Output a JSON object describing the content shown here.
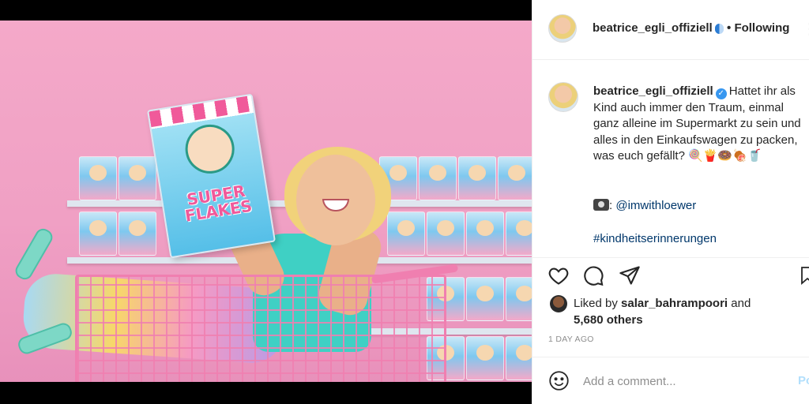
{
  "photo": {
    "package_title": "SUPER FLAKES"
  },
  "post": {
    "header": {
      "username": "beatrice_egli_offiziell",
      "separator": "•",
      "follow_status": "Following",
      "more": "⋮"
    },
    "caption": {
      "username": "beatrice_egli_offiziell",
      "verified_mark": "✓",
      "text": "Hattet ihr als Kind auch immer den Traum, einmal ganz alleine im Supermarkt zu sein und alles in den Einkaufswagen zu packen, was euch gefällt?",
      "emojis": "🍭🍟🍩🍖🥤",
      "credit_prefix": ": ",
      "credit_handle": "@imwithloewer",
      "hashtag": "#kindheitserinnerungen"
    },
    "likes": {
      "prefix": "Liked by ",
      "username": "salar_bahrampoori",
      "and": " and",
      "others": "5,680 others"
    },
    "timestamp": "1 DAY AGO",
    "comment": {
      "placeholder": "Add a comment...",
      "post_label": "Po"
    }
  },
  "icons": {
    "like": "heart-icon",
    "comment": "comment-icon",
    "share": "paper-plane-icon",
    "save": "bookmark-icon",
    "emoji": "smiley-icon",
    "credit": "camera-icon"
  },
  "colors": {
    "link": "#00376b",
    "verified": "#3897f0",
    "post_button": "#b2dffc",
    "photo_background": "#f4a9c9"
  }
}
